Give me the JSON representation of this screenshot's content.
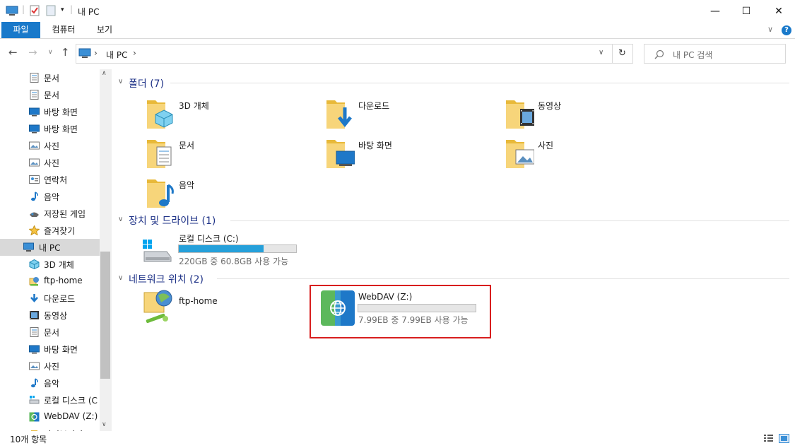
{
  "window": {
    "title": "내 PC"
  },
  "ribbon": {
    "tabs": [
      "파일",
      "컴퓨터",
      "보기"
    ]
  },
  "address": {
    "separator": "›",
    "location": "내 PC",
    "chevron": "›"
  },
  "search": {
    "placeholder": "내 PC 검색"
  },
  "nav": {
    "items": [
      {
        "label": "문서",
        "icon": "document-icon"
      },
      {
        "label": "문서",
        "icon": "document-icon"
      },
      {
        "label": "바탕 화면",
        "icon": "desktop-icon"
      },
      {
        "label": "바탕 화면",
        "icon": "desktop-icon"
      },
      {
        "label": "사진",
        "icon": "pictures-icon"
      },
      {
        "label": "사진",
        "icon": "pictures-icon"
      },
      {
        "label": "연락처",
        "icon": "contacts-icon"
      },
      {
        "label": "음악",
        "icon": "music-icon"
      },
      {
        "label": "저장된 게임",
        "icon": "saved-games-icon"
      },
      {
        "label": "즐겨찾기",
        "icon": "favorites-icon"
      },
      {
        "label": "내 PC",
        "icon": "pc-icon",
        "selected": true
      },
      {
        "label": "3D 개체",
        "icon": "3d-objects-icon"
      },
      {
        "label": "ftp-home",
        "icon": "network-location-icon"
      },
      {
        "label": "다운로드",
        "icon": "downloads-icon"
      },
      {
        "label": "동영상",
        "icon": "videos-icon"
      },
      {
        "label": "문서",
        "icon": "document-icon"
      },
      {
        "label": "바탕 화면",
        "icon": "desktop-icon"
      },
      {
        "label": "사진",
        "icon": "pictures-icon"
      },
      {
        "label": "음악",
        "icon": "music-icon"
      },
      {
        "label": "로컬 디스크 (C",
        "icon": "local-disk-icon"
      },
      {
        "label": "WebDAV (Z:)",
        "icon": "webdav-icon"
      },
      {
        "label": "라이브러리",
        "icon": "library-icon"
      }
    ]
  },
  "groups": {
    "folders": {
      "header": "폴더 (7)",
      "items": [
        {
          "label": "3D 개체",
          "icon": "3d-objects-folder-icon"
        },
        {
          "label": "다운로드",
          "icon": "downloads-folder-icon"
        },
        {
          "label": "동영상",
          "icon": "videos-folder-icon"
        },
        {
          "label": "문서",
          "icon": "documents-folder-icon"
        },
        {
          "label": "바탕 화면",
          "icon": "desktop-folder-icon"
        },
        {
          "label": "사진",
          "icon": "pictures-folder-icon"
        },
        {
          "label": "음악",
          "icon": "music-folder-icon"
        }
      ]
    },
    "drives": {
      "header": "장치 및 드라이브 (1)",
      "items": [
        {
          "label": "로컬 디스크 (C:)",
          "usage": "220GB 중 60.8GB 사용 가능",
          "used_fraction": 0.72
        }
      ]
    },
    "network": {
      "header": "네트워크 위치 (2)",
      "items": [
        {
          "label": "ftp-home"
        },
        {
          "label": "WebDAV (Z:)",
          "usage": "7.99EB 중 7.99EB 사용 가능",
          "used_fraction": 0.0
        }
      ]
    }
  },
  "status": {
    "count": "10개 항목"
  },
  "colors": {
    "accent": "#1979ca",
    "folder": "#f7c94c",
    "highlight": "#d81e1e",
    "drive_bar": "#26a0da"
  }
}
